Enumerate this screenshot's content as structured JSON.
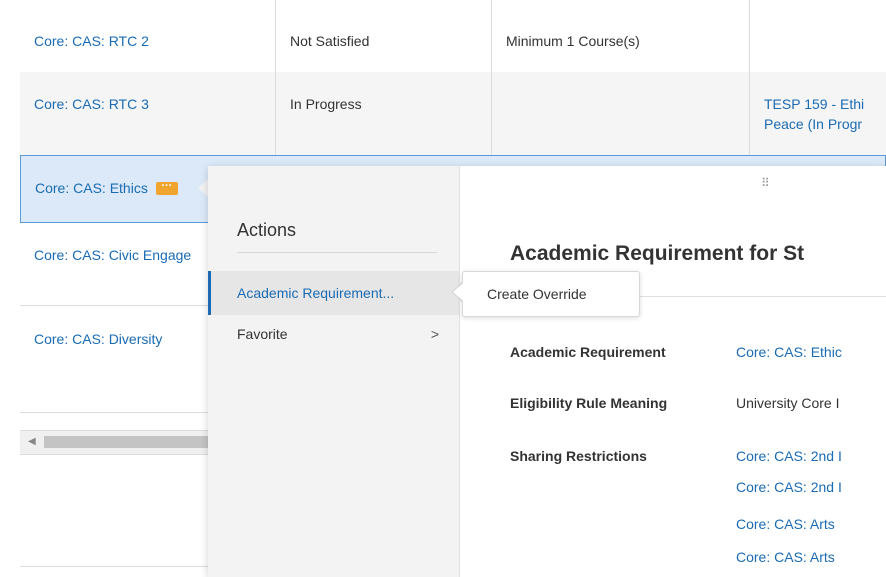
{
  "rows": [
    {
      "requirement": "Core: CAS: RTC 2",
      "status": "Not Satisfied",
      "condition": "Minimum 1 Course(s)",
      "courses": ""
    },
    {
      "requirement": "Core: CAS: RTC 3",
      "status": "In Progress",
      "condition": "",
      "courses": "TESP 159 - Ethi\nPeace (In Progr"
    },
    {
      "requirement": "Core: CAS: Ethics",
      "status": "",
      "condition": "",
      "courses": ""
    },
    {
      "requirement": "Core: CAS: Civic Engage",
      "status": "",
      "condition": "",
      "courses": ""
    },
    {
      "requirement": "Core: CAS: Diversity",
      "status": "",
      "condition": "",
      "courses": ""
    }
  ],
  "badge": "···",
  "actions": {
    "title": "Actions",
    "items": [
      {
        "label": "Academic Requirement..."
      },
      {
        "label": "Favorite",
        "chevron": ">"
      }
    ]
  },
  "submenu": {
    "label": "Create Override"
  },
  "detail": {
    "drag_handle": "⠿",
    "title": "Academic Requirement for St",
    "fields": [
      {
        "label": "Academic Requirement",
        "values": [
          "Core: CAS: Ethic"
        ]
      },
      {
        "label": "Eligibility Rule Meaning",
        "values": [
          "University Core I"
        ]
      },
      {
        "label": "Sharing Restrictions",
        "values": [
          "Core: CAS: 2nd I",
          "Core: CAS: 2nd I",
          "Core: CAS: Arts",
          "Core: CAS: Arts"
        ]
      }
    ]
  },
  "colors": {
    "link": "#1a6bb3",
    "accent_badge": "#f0a530",
    "selected_row": "#dbe9f9"
  }
}
